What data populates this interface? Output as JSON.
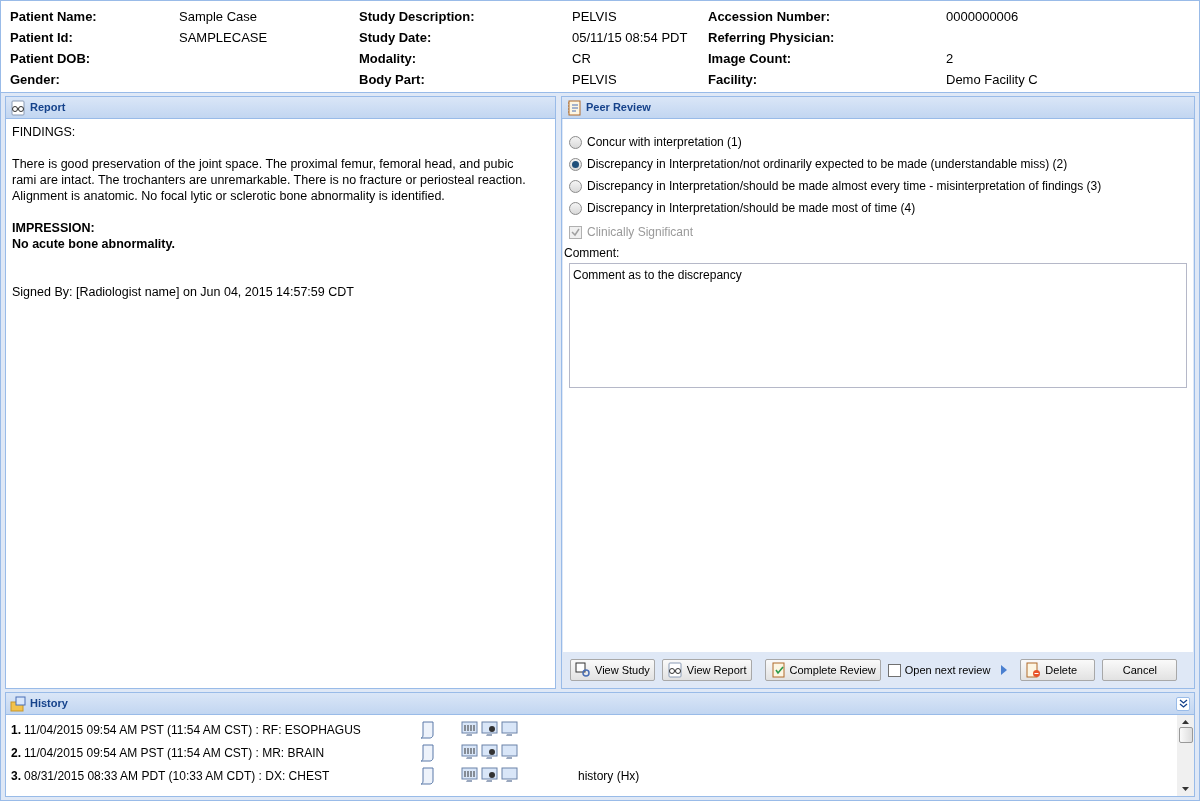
{
  "header": {
    "columns": [
      [
        {
          "label": "Patient Name:",
          "value": "Sample Case"
        },
        {
          "label": "Patient Id:",
          "value": "SAMPLECASE"
        },
        {
          "label": "Patient DOB:"
        },
        {
          "label": "Gender:"
        }
      ],
      [
        {
          "label": "Study Description:",
          "value": "PELVIS"
        },
        {
          "label": "Study Date:",
          "value": "05/11/15 08:54 PDT"
        },
        {
          "label": "Modality:",
          "value": "CR"
        },
        {
          "label": "Body Part:",
          "value": "PELVIS"
        }
      ],
      [
        {
          "label": "Accession Number:",
          "value": "0000000006"
        },
        {
          "label": "Referring Physician:"
        },
        {
          "label": "Image Count:",
          "value": "2"
        },
        {
          "label": "Facility:",
          "value": "Demo Facility C"
        }
      ]
    ]
  },
  "report": {
    "title": "Report",
    "sections": [
      {
        "lines": [
          {
            "text": "FINDINGS:",
            "bold": false
          }
        ]
      },
      {
        "lines": [
          {
            "text": "There is good preservation of the joint space. The proximal femur, femoral head, and pubic rami are intact. The trochanters are unremarkable. There is no fracture or periosteal reaction. Alignment is anatomic. No focal lytic or sclerotic bone abnormality is identified.",
            "bold": false
          }
        ]
      },
      {
        "lines": [
          {
            "text": "IMPRESSION:",
            "bold": true
          },
          {
            "text": "No acute bone abnormality.",
            "bold": true
          }
        ]
      },
      {
        "lines": [
          {
            "text": "Signed By: [Radiologist name] on Jun 04, 2015 14:57:59 CDT",
            "bold": false
          }
        ]
      }
    ]
  },
  "peer_review": {
    "title": "Peer Review",
    "options": [
      {
        "label": "Concur with interpretation (1)",
        "selected": false
      },
      {
        "label": "Discrepancy in Interpretation/not ordinarily expected to be made (understandable miss) (2)",
        "selected": true
      },
      {
        "label": "Discrepancy in Interpretation/should be made almost every time - misinterpretation of findings (3)",
        "selected": false
      },
      {
        "label": "Discrepancy in Interpretation/should be made most of time (4)",
        "selected": false
      }
    ],
    "clinically_significant": {
      "label": "Clinically Significant",
      "checked": true,
      "disabled": true
    },
    "comment": {
      "label": "Comment:",
      "value": "Comment as to the discrepancy"
    },
    "actions": [
      {
        "kind": "study",
        "label": "View Study"
      },
      {
        "kind": "report",
        "label": "View Report"
      },
      {
        "kind": "complete",
        "label": "Complete Review"
      },
      {
        "kind": "checkbox",
        "label": "Open next review",
        "checked": false
      },
      {
        "kind": "delete",
        "label": "Delete"
      },
      {
        "kind": "plain",
        "label": "Cancel"
      }
    ]
  },
  "history": {
    "title": "History",
    "rows": [
      {
        "number": "1.",
        "text": "11/04/2015 09:54 AM PST (11:54 AM CST) : RF: ESOPHAGUS"
      },
      {
        "number": "2.",
        "text": "11/04/2015 09:54 AM PST (11:54 AM CST) : MR: BRAIN"
      },
      {
        "number": "3.",
        "text": "08/31/2015 08:33 AM PDT (10:33 AM CDT) : DX: CHEST",
        "note": "history (Hx)"
      }
    ]
  }
}
